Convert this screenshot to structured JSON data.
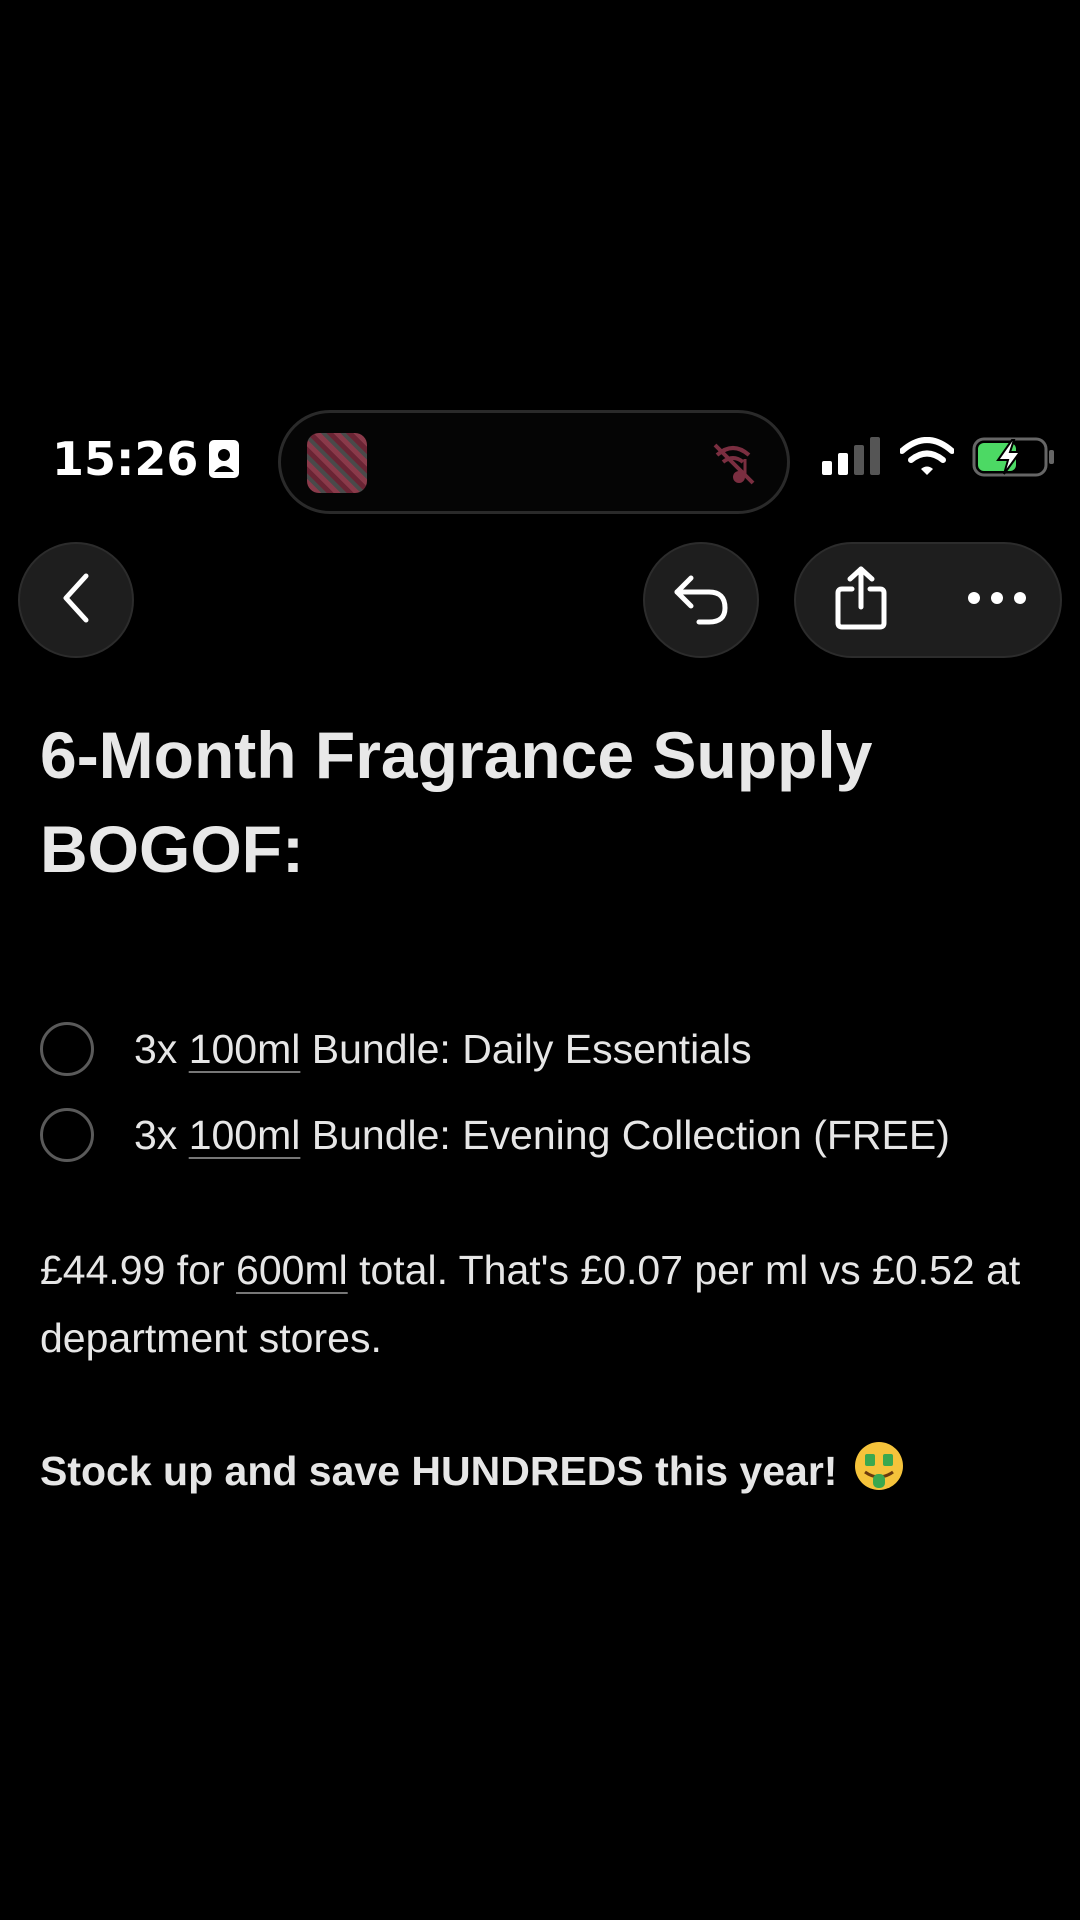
{
  "status_bar": {
    "time": "15:26"
  },
  "icons": {
    "back": "chevron-left-icon",
    "undo": "undo-arrow-icon",
    "share": "share-icon",
    "more": "ellipsis-icon",
    "mute": "muted-icon",
    "signal": "cellular-signal-icon",
    "wifi": "wifi-icon",
    "battery": "battery-charging-icon"
  },
  "colors": {
    "battery_fill": "#4cd964",
    "background": "#000000",
    "text": "#e6e6e6"
  },
  "note": {
    "title": "6-Month Fragrance Supply BOGOF:",
    "checklist": [
      {
        "prefix": "3x ",
        "link": "100ml",
        "suffix": " Bundle: Daily Essentials",
        "checked": false
      },
      {
        "prefix": "3x ",
        "link": "100ml",
        "suffix": " Bundle: Evening Collection (FREE)",
        "checked": false
      }
    ],
    "price": {
      "part1": "£44.99 for ",
      "link": "600ml",
      "part2": " total. That's £0.07 per ml vs £0.52 at department stores."
    },
    "cta": "Stock up and save HUNDREDS this year!"
  }
}
